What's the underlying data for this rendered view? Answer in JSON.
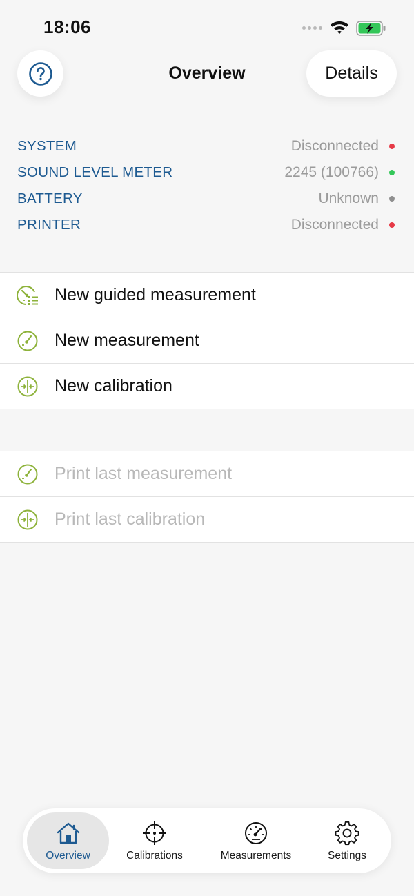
{
  "status_bar": {
    "time": "18:06"
  },
  "nav": {
    "title": "Overview",
    "details_label": "Details"
  },
  "device_status": [
    {
      "label": "SYSTEM",
      "value": "Disconnected",
      "indicator": "red"
    },
    {
      "label": "SOUND LEVEL METER",
      "value": "2245 (100766)",
      "indicator": "green"
    },
    {
      "label": "BATTERY",
      "value": "Unknown",
      "indicator": "gray"
    },
    {
      "label": "PRINTER",
      "value": "Disconnected",
      "indicator": "red"
    }
  ],
  "actions": [
    {
      "label": "New guided measurement",
      "icon": "guided-measurement-icon"
    },
    {
      "label": "New measurement",
      "icon": "gauge-icon"
    },
    {
      "label": "New calibration",
      "icon": "calibration-icon"
    }
  ],
  "print_actions": [
    {
      "label": "Print last measurement",
      "icon": "gauge-icon",
      "enabled": false
    },
    {
      "label": "Print last calibration",
      "icon": "calibration-icon",
      "enabled": false
    }
  ],
  "tabs": [
    {
      "label": "Overview",
      "icon": "home-icon",
      "active": true
    },
    {
      "label": "Calibrations",
      "icon": "crosshair-icon",
      "active": false
    },
    {
      "label": "Measurements",
      "icon": "speedometer-icon",
      "active": false
    },
    {
      "label": "Settings",
      "icon": "gear-icon",
      "active": false
    }
  ],
  "colors": {
    "accent": "#1d5a91",
    "icon_green": "#8db23a",
    "status_red": "#e63a47",
    "status_green": "#34c759",
    "status_gray": "#8f8f8f",
    "battery_green": "#34c759"
  }
}
